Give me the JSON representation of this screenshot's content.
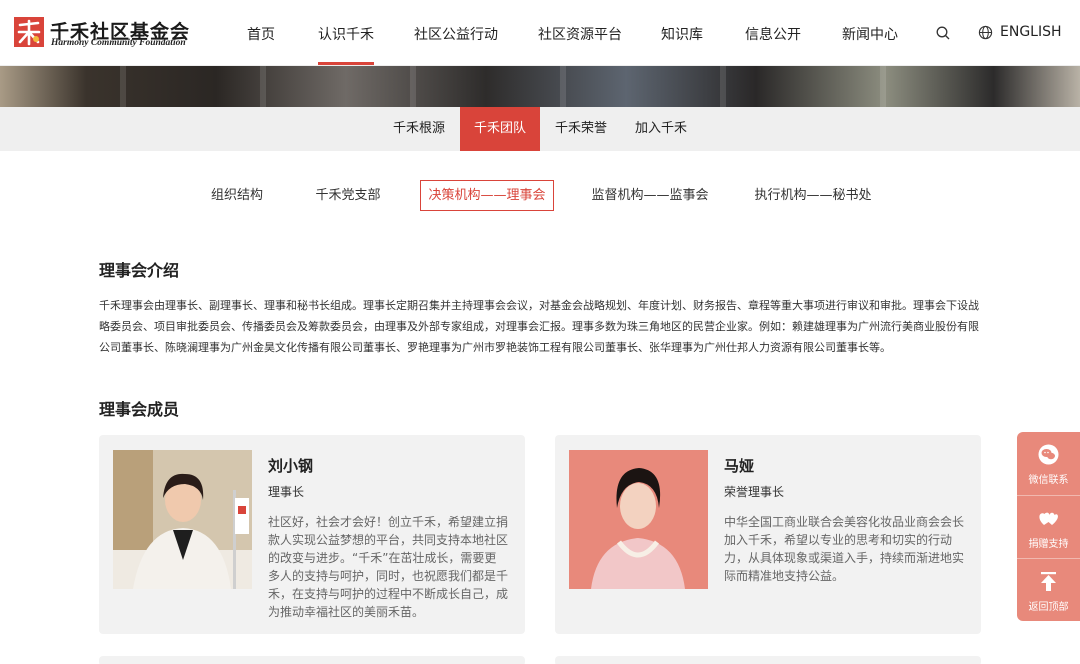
{
  "header": {
    "logo_cn": "千禾社区基金会",
    "logo_en": "Harmony Community Foundation",
    "nav": [
      {
        "label": "首页",
        "active": false
      },
      {
        "label": "认识千禾",
        "active": true
      },
      {
        "label": "社区公益行动",
        "active": false
      },
      {
        "label": "社区资源平台",
        "active": false
      },
      {
        "label": "知识库",
        "active": false
      },
      {
        "label": "信息公开",
        "active": false
      },
      {
        "label": "新闻中心",
        "active": false
      }
    ],
    "search_icon": "search-icon",
    "language_label": "ENGLISH"
  },
  "subnav": [
    {
      "label": "千禾根源",
      "active": false
    },
    {
      "label": "千禾团队",
      "active": true
    },
    {
      "label": "千禾荣誉",
      "active": false
    },
    {
      "label": "加入千禾",
      "active": false
    }
  ],
  "org_tabs": [
    {
      "label": "组织结构",
      "active": false
    },
    {
      "label": "千禾党支部",
      "active": false
    },
    {
      "label": "决策机构——理事会",
      "active": true
    },
    {
      "label": "监督机构——监事会",
      "active": false
    },
    {
      "label": "执行机构——秘书处",
      "active": false
    }
  ],
  "intro": {
    "title": "理事会介绍",
    "text": "千禾理事会由理事长、副理事长、理事和秘书长组成。理事长定期召集并主持理事会会议，对基金会战略规划、年度计划、财务报告、章程等重大事项进行审议和审批。理事会下设战略委员会、项目审批委员会、传播委员会及筹款委员会，由理事及外部专家组成，对理事会汇报。理事多数为珠三角地区的民营企业家。例如：赖建雄理事为广州流行美商业股份有限公司董事长、陈晓澜理事为广州金昊文化传播有限公司董事长、罗艳理事为广州市罗艳装饰工程有限公司董事长、张华理事为广州仕邦人力资源有限公司董事长等。"
  },
  "members": {
    "title": "理事会成员",
    "items": [
      {
        "name": "刘小钢",
        "role": "理事长",
        "desc": "社区好，社会才会好！创立千禾，希望建立捐款人实现公益梦想的平台，共同支持本地社区的改变与进步。“千禾”在茁壮成长，需要更多人的支持与呵护，同时，也祝愿我们都是千禾，在支持与呵护的过程中不断成长自己，成为推动幸福社区的美丽禾苗。"
      },
      {
        "name": "马娅",
        "role": "荣誉理事长",
        "desc": "中华全国工商业联合会美容化妆品业商会会长加入千禾，希望以专业的思考和切实的行动力，从具体现象或渠道入手，持续而渐进地实际而精准地支持公益。"
      }
    ]
  },
  "float_menu": [
    {
      "label": "微信联系",
      "icon": "wechat-icon"
    },
    {
      "label": "捐赠支持",
      "icon": "donate-hearts-icon"
    },
    {
      "label": "返回顶部",
      "icon": "back-to-top-icon"
    }
  ],
  "colors": {
    "accent": "#d9443a",
    "float_bg": "#e8897b",
    "card_bg": "#f2f2f2"
  }
}
